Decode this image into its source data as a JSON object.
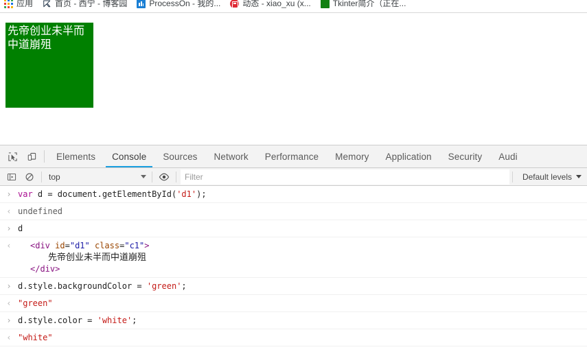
{
  "bookmark_bar": {
    "items": [
      {
        "icon": "apps-grid-icon",
        "label": "应用"
      },
      {
        "icon": "cnblogs-icon",
        "label": "首页 - 西宁 - 博客园"
      },
      {
        "icon": "processon-icon",
        "label": "ProcessOn - 我的..."
      },
      {
        "icon": "bilibili-icon",
        "label": "动态 - xiao_xu (x..."
      },
      {
        "icon": "green-square-icon",
        "label": "Tkinter简介（正在..."
      }
    ]
  },
  "page": {
    "green_box": {
      "id": "d1",
      "class": "c1",
      "text": "先帝创业未半而中道崩殂",
      "background_color": "#008000",
      "text_color": "#ffffff"
    }
  },
  "devtools": {
    "toolbar_icons": [
      {
        "name": "inspect-element-icon",
        "title": "Inspect"
      },
      {
        "name": "device-toolbar-icon",
        "title": "Toggle device toolbar"
      }
    ],
    "tabs": [
      {
        "label": "Elements",
        "active": false
      },
      {
        "label": "Console",
        "active": true
      },
      {
        "label": "Sources",
        "active": false
      },
      {
        "label": "Network",
        "active": false
      },
      {
        "label": "Performance",
        "active": false
      },
      {
        "label": "Memory",
        "active": false
      },
      {
        "label": "Application",
        "active": false
      },
      {
        "label": "Security",
        "active": false
      },
      {
        "label": "Audi",
        "active": false
      }
    ],
    "active_tab_underline_color": "#1a9fe0",
    "console_toolbar": {
      "sidebar_toggle_icon": "console-sidebar-icon",
      "clear_icon": "clear-console-icon",
      "context": "top",
      "eye_icon": "live-expression-eye-icon",
      "filter_placeholder": "Filter",
      "filter_value": "",
      "levels": "Default levels"
    },
    "console_log": [
      {
        "kind": "input",
        "marker": "›",
        "parts": [
          {
            "t": "kw",
            "v": "var "
          },
          {
            "t": "plain",
            "v": "d = document.getElementById("
          },
          {
            "t": "str",
            "v": "'d1'"
          },
          {
            "t": "plain",
            "v": ");"
          }
        ]
      },
      {
        "kind": "output",
        "marker": "‹",
        "parts": [
          {
            "t": "result",
            "v": "undefined"
          }
        ]
      },
      {
        "kind": "input",
        "marker": "›",
        "parts": [
          {
            "t": "plain",
            "v": "d"
          }
        ]
      },
      {
        "kind": "output-html",
        "marker": "‹",
        "open_tag_parts": [
          {
            "t": "punct",
            "v": "<"
          },
          {
            "t": "tag",
            "v": "div"
          },
          {
            "t": "plain",
            "v": " "
          },
          {
            "t": "attr",
            "v": "id"
          },
          {
            "t": "plain",
            "v": "="
          },
          {
            "t": "attrval",
            "v": "\"d1\""
          },
          {
            "t": "plain",
            "v": " "
          },
          {
            "t": "attr",
            "v": "class"
          },
          {
            "t": "plain",
            "v": "="
          },
          {
            "t": "attrval",
            "v": "\"c1\""
          },
          {
            "t": "punct",
            "v": ">"
          }
        ],
        "inner_text": "先帝创业未半而中道崩殂",
        "close_tag_parts": [
          {
            "t": "punct",
            "v": "</"
          },
          {
            "t": "tag",
            "v": "div"
          },
          {
            "t": "punct",
            "v": ">"
          }
        ]
      },
      {
        "kind": "input",
        "marker": "›",
        "parts": [
          {
            "t": "plain",
            "v": "d.style.backgroundColor = "
          },
          {
            "t": "str",
            "v": "'green'"
          },
          {
            "t": "plain",
            "v": ";"
          }
        ]
      },
      {
        "kind": "output",
        "marker": "‹",
        "parts": [
          {
            "t": "strres",
            "v": "\"green\""
          }
        ]
      },
      {
        "kind": "input",
        "marker": "›",
        "parts": [
          {
            "t": "plain",
            "v": "d.style.color = "
          },
          {
            "t": "str",
            "v": "'white'"
          },
          {
            "t": "plain",
            "v": ";"
          }
        ]
      },
      {
        "kind": "output",
        "marker": "‹",
        "parts": [
          {
            "t": "strres",
            "v": "\"white\""
          }
        ]
      }
    ]
  }
}
